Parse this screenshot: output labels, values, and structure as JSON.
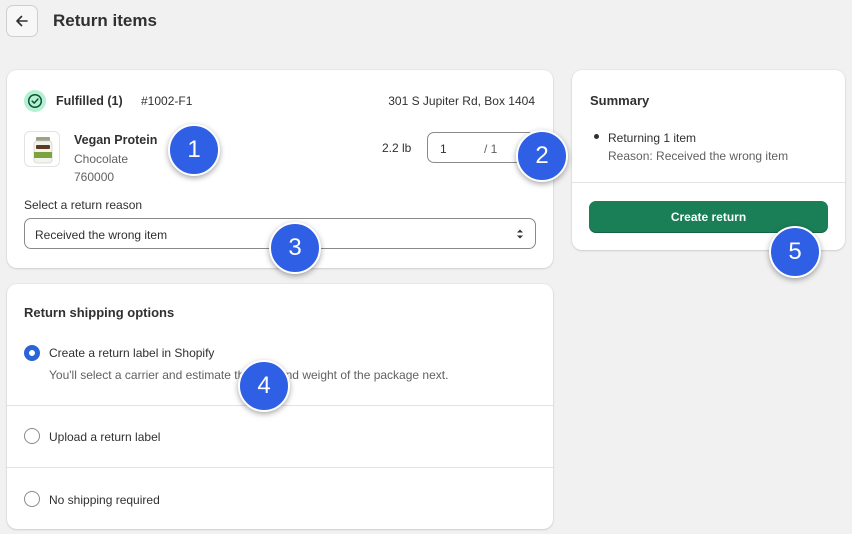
{
  "page": {
    "title": "Return items"
  },
  "fulfillment": {
    "status_label": "Fulfilled (1)",
    "order_number": "#1002-F1",
    "address": "301 S Jupiter Rd, Box 1404",
    "product": {
      "name": "Vegan Protein",
      "variant": "Chocolate",
      "sku": "760000",
      "weight": "2.2 lb"
    },
    "quantity": {
      "value": "1",
      "max_label": "/ 1"
    },
    "reason_label": "Select a return reason",
    "reason_value": "Received the wrong item"
  },
  "shipping": {
    "title": "Return shipping options",
    "options": [
      {
        "label": "Create a return label in Shopify",
        "help": "You'll select a carrier and estimate the size and weight of the package next.",
        "selected": true
      },
      {
        "label": "Upload a return label",
        "selected": false
      },
      {
        "label": "No shipping required",
        "selected": false
      }
    ]
  },
  "summary": {
    "title": "Summary",
    "line": "Returning 1 item",
    "reason": "Reason: Received the wrong item",
    "button_label": "Create return"
  },
  "badges": [
    "1",
    "2",
    "3",
    "4",
    "5"
  ],
  "colors": {
    "primary": "#1a7e56",
    "radio_selected": "#2b64d6",
    "badge": "#2f5fe5",
    "fulfilled_bg": "#b4f0d2"
  }
}
